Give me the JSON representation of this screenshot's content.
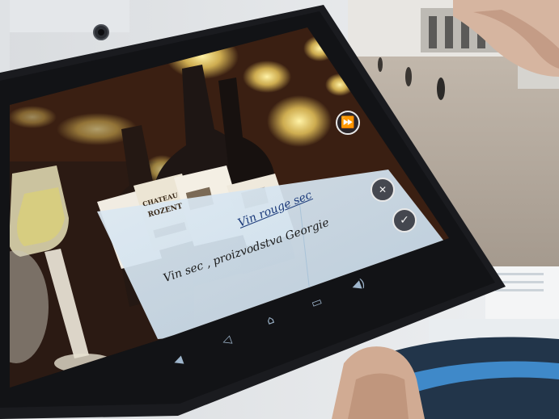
{
  "captions": {
    "wine_red": "Vin rouge sec",
    "wine_white": "Vin sec , proizvodstva Georgie"
  },
  "label_texts": {
    "chateau": "CHATEAU",
    "rozen": "ROZENT"
  },
  "buttons": {
    "next_symbol": "⏩",
    "close_symbol": "✕",
    "confirm_symbol": "✓"
  },
  "nav_bar": {
    "back_symbol": "◁",
    "home_symbol": "⌂",
    "recent_symbol": "▭",
    "volume_down_symbol": "◀",
    "volume_up_symbol": "◀)"
  },
  "icons": [
    "camera-icon",
    "next-icon",
    "close-icon",
    "check-icon",
    "back-icon",
    "home-icon",
    "recent-apps-icon",
    "volume-down-icon",
    "volume-up-icon"
  ],
  "colors": {
    "tablet_bezel": "#1a1b1f",
    "overlay_panel": "#cfe1ef",
    "ar_background": "#3a1f12",
    "bokeh_light": "#f3d060"
  }
}
